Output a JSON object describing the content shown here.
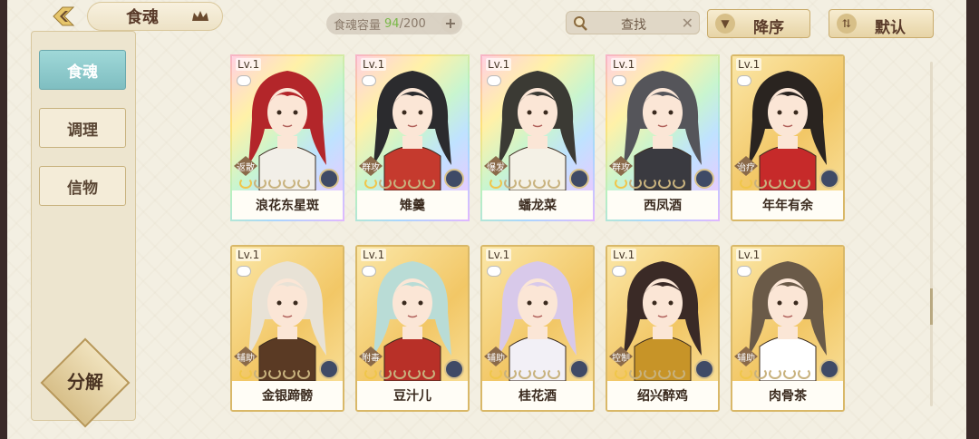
{
  "header": {
    "title": "食魂",
    "capacity_label": "食魂容量",
    "capacity_current": "94",
    "capacity_max": "/200",
    "plus": "+",
    "search_placeholder": "查找",
    "search_clear": "✕",
    "sort_label": "降序",
    "default_label": "默认"
  },
  "sidebar": {
    "items": [
      {
        "label": "食魂",
        "active": true
      },
      {
        "label": "调理",
        "active": false
      },
      {
        "label": "信物",
        "active": false
      }
    ],
    "decompose_label": "分解"
  },
  "cards": [
    {
      "level": "Lv.1",
      "name": "浪花东星斑",
      "role": "返散",
      "frame": "rainbow",
      "hair": "#b3262a",
      "outfit": "#f2efe8"
    },
    {
      "level": "Lv.1",
      "name": "雉羹",
      "role": "群攻",
      "frame": "rainbow",
      "hair": "#2b2b2e",
      "outfit": "#c53a2e"
    },
    {
      "level": "Lv.1",
      "name": "蟠龙菜",
      "role": "爆发",
      "frame": "rainbow",
      "hair": "#3b3a34",
      "outfit": "#f4f1e6"
    },
    {
      "level": "Lv.1",
      "name": "西凤酒",
      "role": "群攻",
      "frame": "rainbow",
      "hair": "#55555a",
      "outfit": "#3a3a40"
    },
    {
      "level": "Lv.1",
      "name": "年年有余",
      "role": "治疗",
      "frame": "gold",
      "hair": "#2a2420",
      "outfit": "#c62a2a"
    },
    {
      "level": "Lv.1",
      "name": "金银蹄髈",
      "role": "辅助",
      "frame": "gold",
      "hair": "#e8e2d6",
      "outfit": "#5a3a24"
    },
    {
      "level": "Lv.1",
      "name": "豆汁儿",
      "role": "附毒",
      "frame": "gold",
      "hair": "#b9dcd6",
      "outfit": "#b83028"
    },
    {
      "level": "Lv.1",
      "name": "桂花酒",
      "role": "辅助",
      "frame": "gold",
      "hair": "#d8c9ea",
      "outfit": "#f2f0f6"
    },
    {
      "level": "Lv.1",
      "name": "绍兴醉鸡",
      "role": "控制",
      "frame": "gold",
      "hair": "#3a2a26",
      "outfit": "#c79428"
    },
    {
      "level": "Lv.1",
      "name": "肉骨茶",
      "role": "辅助",
      "frame": "gold",
      "hair": "#6a5a48",
      "outfit": "#ffffff"
    }
  ],
  "colors": {
    "accent_teal": "#8fcccf",
    "gold_frame": "#d9b868",
    "capacity_current": "#7ab848"
  },
  "icons": {
    "back": "back-arrow-icon",
    "title_ornament": "crown-icon",
    "search": "search-icon",
    "sort": "sort-down-icon",
    "default": "sort-toggle-icon",
    "element": "element-icon"
  }
}
